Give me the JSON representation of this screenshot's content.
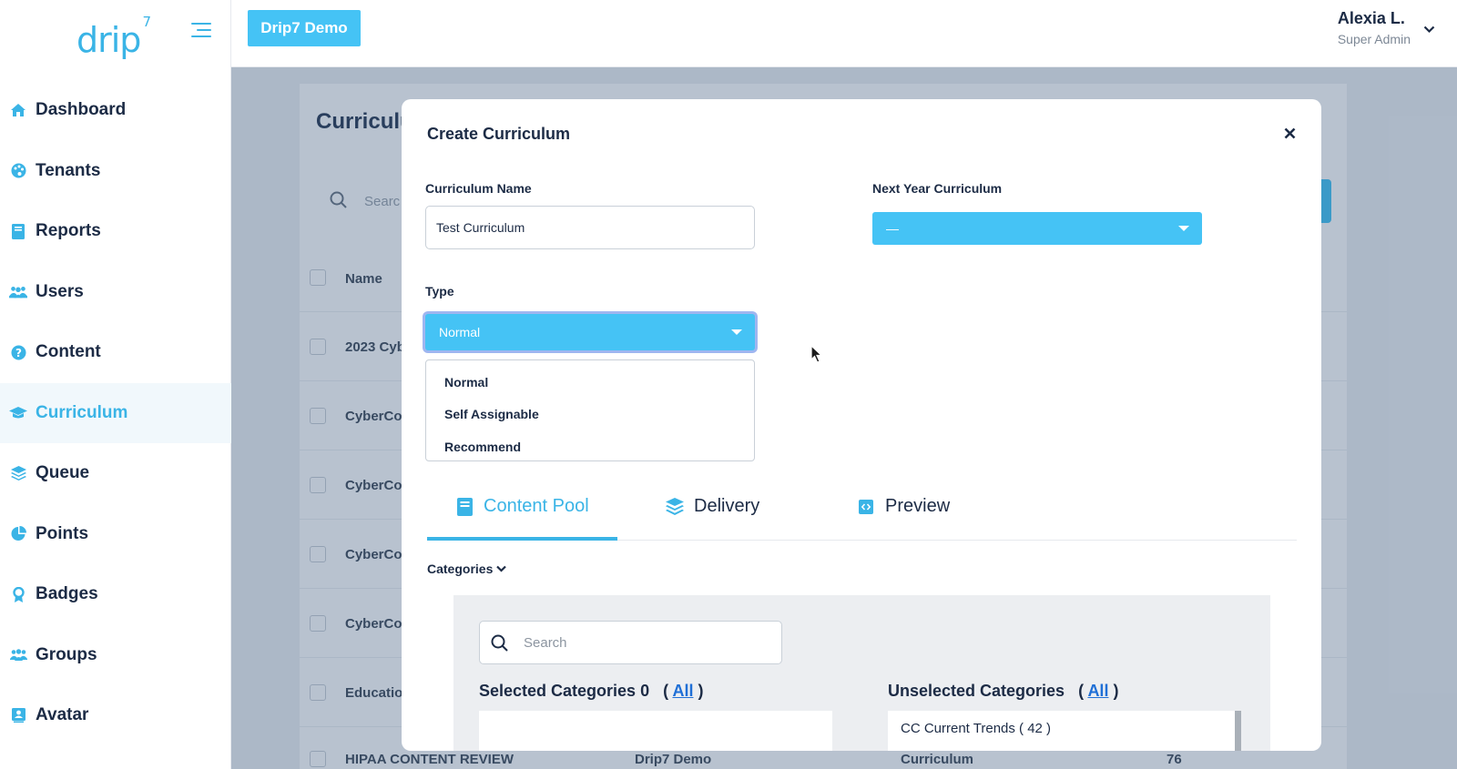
{
  "brand": {
    "logo_text": "drip",
    "logo_sup": "7"
  },
  "sidebar": {
    "items": [
      {
        "label": "Dashboard",
        "icon": "home-icon"
      },
      {
        "label": "Tenants",
        "icon": "palette-icon"
      },
      {
        "label": "Reports",
        "icon": "book-icon"
      },
      {
        "label": "Users",
        "icon": "users-icon"
      },
      {
        "label": "Content",
        "icon": "question-circle-icon"
      },
      {
        "label": "Curriculum",
        "icon": "graduation-cap-icon",
        "active": true
      },
      {
        "label": "Queue",
        "icon": "layers-icon"
      },
      {
        "label": "Points",
        "icon": "pie-chart-icon"
      },
      {
        "label": "Badges",
        "icon": "award-icon"
      },
      {
        "label": "Groups",
        "icon": "group-icon"
      },
      {
        "label": "Avatar",
        "icon": "portrait-icon"
      }
    ]
  },
  "header": {
    "tenant_button": "Drip7 Demo",
    "user_name": "Alexia L.",
    "user_role": "Super Admin"
  },
  "background": {
    "title": "Curriculu",
    "search_placeholder": "Searc",
    "column_name": "Name",
    "rows": [
      {
        "name": "2023 Cyb"
      },
      {
        "name": "CyberCor"
      },
      {
        "name": "CyberCor"
      },
      {
        "name": "CyberCor"
      },
      {
        "name": "CyberCor"
      },
      {
        "name": "Educatio"
      },
      {
        "name": "HIPAA CONTENT REVIEW",
        "tenant": "Drip7 Demo",
        "type": "Curriculum",
        "count": "76"
      }
    ]
  },
  "modal": {
    "title": "Create Curriculum",
    "curriculum_name_label": "Curriculum Name",
    "curriculum_name_value": "Test Curriculum",
    "next_year_label": "Next Year Curriculum",
    "next_year_value": "—",
    "type_label": "Type",
    "type_value": "Normal",
    "type_options": [
      "Normal",
      "Self Assignable",
      "Recommend"
    ],
    "tabs": [
      {
        "label": "Content Pool",
        "icon": "book-icon",
        "active": true
      },
      {
        "label": "Delivery",
        "icon": "layers-icon"
      },
      {
        "label": "Preview",
        "icon": "code-square-icon"
      }
    ],
    "categories_toggle": "Categories",
    "category_search_placeholder": "Search",
    "selected_label": "Selected Categories 0",
    "unselected_label": "Unselected Categories",
    "all_link": "All",
    "unselected_items": [
      "CC Current Trends ( 42 )"
    ]
  },
  "colors": {
    "accent": "#45c3f5",
    "brand_text": "#3ab4e6",
    "nav_text": "#1c2b45",
    "link": "#1f6fd6"
  }
}
